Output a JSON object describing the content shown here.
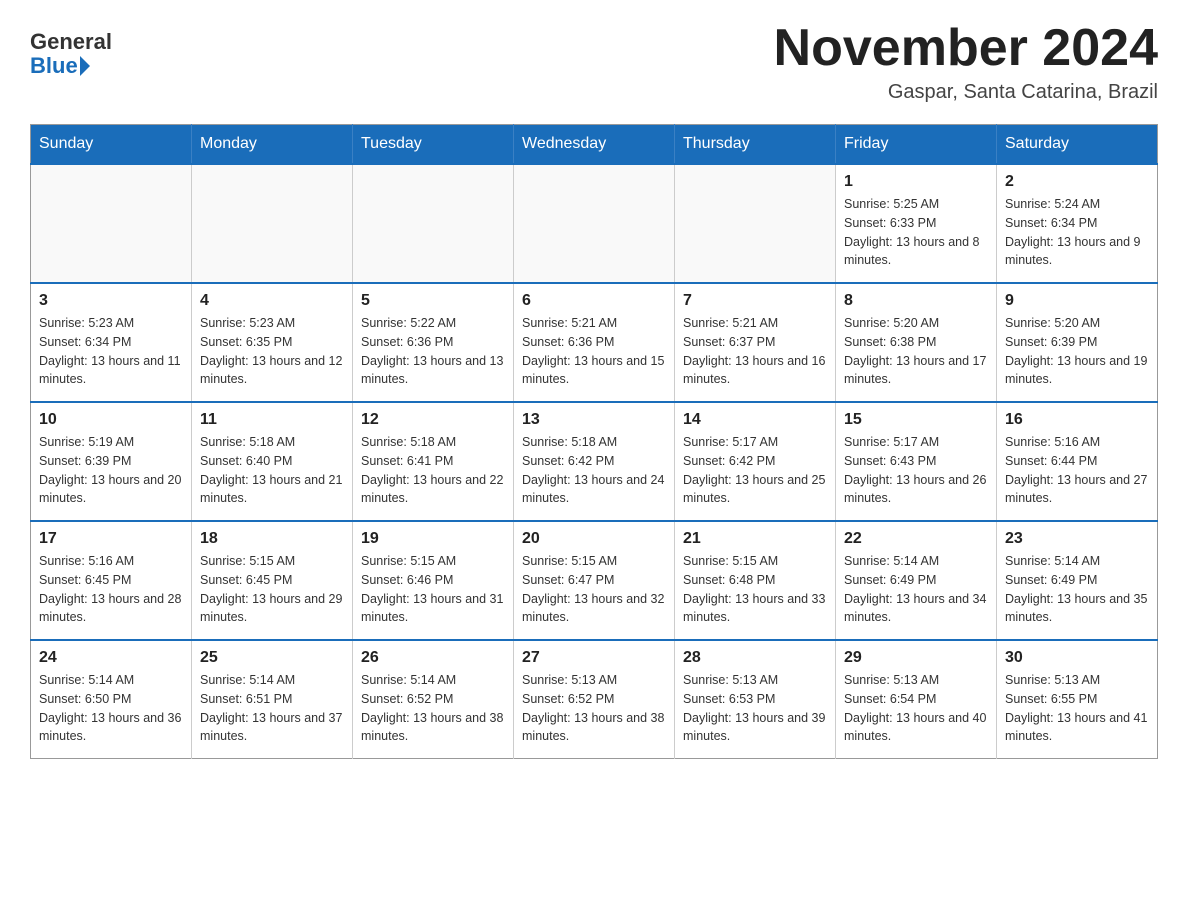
{
  "logo": {
    "general": "General",
    "blue": "Blue"
  },
  "title": "November 2024",
  "location": "Gaspar, Santa Catarina, Brazil",
  "days_of_week": [
    "Sunday",
    "Monday",
    "Tuesday",
    "Wednesday",
    "Thursday",
    "Friday",
    "Saturday"
  ],
  "weeks": [
    [
      {
        "day": "",
        "info": ""
      },
      {
        "day": "",
        "info": ""
      },
      {
        "day": "",
        "info": ""
      },
      {
        "day": "",
        "info": ""
      },
      {
        "day": "",
        "info": ""
      },
      {
        "day": "1",
        "info": "Sunrise: 5:25 AM\nSunset: 6:33 PM\nDaylight: 13 hours and 8 minutes."
      },
      {
        "day": "2",
        "info": "Sunrise: 5:24 AM\nSunset: 6:34 PM\nDaylight: 13 hours and 9 minutes."
      }
    ],
    [
      {
        "day": "3",
        "info": "Sunrise: 5:23 AM\nSunset: 6:34 PM\nDaylight: 13 hours and 11 minutes."
      },
      {
        "day": "4",
        "info": "Sunrise: 5:23 AM\nSunset: 6:35 PM\nDaylight: 13 hours and 12 minutes."
      },
      {
        "day": "5",
        "info": "Sunrise: 5:22 AM\nSunset: 6:36 PM\nDaylight: 13 hours and 13 minutes."
      },
      {
        "day": "6",
        "info": "Sunrise: 5:21 AM\nSunset: 6:36 PM\nDaylight: 13 hours and 15 minutes."
      },
      {
        "day": "7",
        "info": "Sunrise: 5:21 AM\nSunset: 6:37 PM\nDaylight: 13 hours and 16 minutes."
      },
      {
        "day": "8",
        "info": "Sunrise: 5:20 AM\nSunset: 6:38 PM\nDaylight: 13 hours and 17 minutes."
      },
      {
        "day": "9",
        "info": "Sunrise: 5:20 AM\nSunset: 6:39 PM\nDaylight: 13 hours and 19 minutes."
      }
    ],
    [
      {
        "day": "10",
        "info": "Sunrise: 5:19 AM\nSunset: 6:39 PM\nDaylight: 13 hours and 20 minutes."
      },
      {
        "day": "11",
        "info": "Sunrise: 5:18 AM\nSunset: 6:40 PM\nDaylight: 13 hours and 21 minutes."
      },
      {
        "day": "12",
        "info": "Sunrise: 5:18 AM\nSunset: 6:41 PM\nDaylight: 13 hours and 22 minutes."
      },
      {
        "day": "13",
        "info": "Sunrise: 5:18 AM\nSunset: 6:42 PM\nDaylight: 13 hours and 24 minutes."
      },
      {
        "day": "14",
        "info": "Sunrise: 5:17 AM\nSunset: 6:42 PM\nDaylight: 13 hours and 25 minutes."
      },
      {
        "day": "15",
        "info": "Sunrise: 5:17 AM\nSunset: 6:43 PM\nDaylight: 13 hours and 26 minutes."
      },
      {
        "day": "16",
        "info": "Sunrise: 5:16 AM\nSunset: 6:44 PM\nDaylight: 13 hours and 27 minutes."
      }
    ],
    [
      {
        "day": "17",
        "info": "Sunrise: 5:16 AM\nSunset: 6:45 PM\nDaylight: 13 hours and 28 minutes."
      },
      {
        "day": "18",
        "info": "Sunrise: 5:15 AM\nSunset: 6:45 PM\nDaylight: 13 hours and 29 minutes."
      },
      {
        "day": "19",
        "info": "Sunrise: 5:15 AM\nSunset: 6:46 PM\nDaylight: 13 hours and 31 minutes."
      },
      {
        "day": "20",
        "info": "Sunrise: 5:15 AM\nSunset: 6:47 PM\nDaylight: 13 hours and 32 minutes."
      },
      {
        "day": "21",
        "info": "Sunrise: 5:15 AM\nSunset: 6:48 PM\nDaylight: 13 hours and 33 minutes."
      },
      {
        "day": "22",
        "info": "Sunrise: 5:14 AM\nSunset: 6:49 PM\nDaylight: 13 hours and 34 minutes."
      },
      {
        "day": "23",
        "info": "Sunrise: 5:14 AM\nSunset: 6:49 PM\nDaylight: 13 hours and 35 minutes."
      }
    ],
    [
      {
        "day": "24",
        "info": "Sunrise: 5:14 AM\nSunset: 6:50 PM\nDaylight: 13 hours and 36 minutes."
      },
      {
        "day": "25",
        "info": "Sunrise: 5:14 AM\nSunset: 6:51 PM\nDaylight: 13 hours and 37 minutes."
      },
      {
        "day": "26",
        "info": "Sunrise: 5:14 AM\nSunset: 6:52 PM\nDaylight: 13 hours and 38 minutes."
      },
      {
        "day": "27",
        "info": "Sunrise: 5:13 AM\nSunset: 6:52 PM\nDaylight: 13 hours and 38 minutes."
      },
      {
        "day": "28",
        "info": "Sunrise: 5:13 AM\nSunset: 6:53 PM\nDaylight: 13 hours and 39 minutes."
      },
      {
        "day": "29",
        "info": "Sunrise: 5:13 AM\nSunset: 6:54 PM\nDaylight: 13 hours and 40 minutes."
      },
      {
        "day": "30",
        "info": "Sunrise: 5:13 AM\nSunset: 6:55 PM\nDaylight: 13 hours and 41 minutes."
      }
    ]
  ]
}
